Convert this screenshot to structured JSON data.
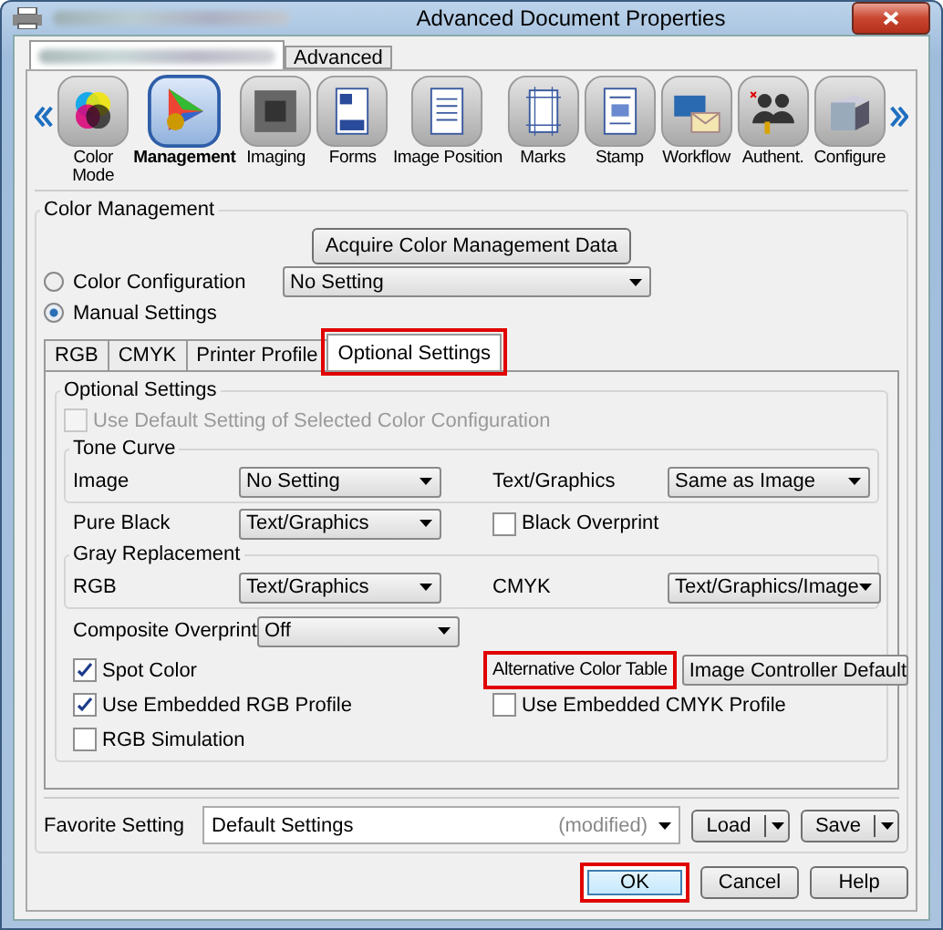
{
  "window": {
    "title": "Advanced Document Properties"
  },
  "top_tabs": [
    {
      "kind": "blurred",
      "selected": true
    },
    {
      "kind": "text",
      "label": "Advanced",
      "selected": false
    }
  ],
  "categories": [
    {
      "label": "Color Mode",
      "kind": "color",
      "selected": false
    },
    {
      "label": "Management",
      "kind": "gamut",
      "selected": true
    },
    {
      "label": "Imaging",
      "kind": "imaging",
      "selected": false
    },
    {
      "label": "Forms",
      "kind": "forms",
      "selected": false
    },
    {
      "label": "Image Position",
      "kind": "position",
      "selected": false
    },
    {
      "label": "Marks",
      "kind": "marks",
      "selected": false
    },
    {
      "label": "Stamp",
      "kind": "stamp",
      "selected": false
    },
    {
      "label": "Workflow",
      "kind": "workflow",
      "selected": false
    },
    {
      "label": "Authent.",
      "kind": "auth",
      "selected": false
    },
    {
      "label": "Configure",
      "kind": "configure",
      "selected": false
    }
  ],
  "color_management": {
    "title": "Color Management",
    "acquire_button": "Acquire Color Management Data",
    "modes": [
      {
        "label": "Color Configuration",
        "selected": false
      },
      {
        "label": "Manual Settings",
        "selected": true
      }
    ],
    "configuration_value": "No Setting",
    "tabs": [
      {
        "label": "RGB",
        "selected": false,
        "highlighted": false
      },
      {
        "label": "CMYK",
        "selected": false,
        "highlighted": false
      },
      {
        "label": "Printer Profile",
        "selected": false,
        "highlighted": false
      },
      {
        "label": "Optional Settings",
        "selected": true,
        "highlighted": true
      }
    ],
    "optional_settings": {
      "title": "Optional Settings",
      "use_default": {
        "label": "Use Default Setting of Selected Color Configuration",
        "checked": false,
        "disabled": true
      },
      "tone_curve": {
        "title": "Tone Curve",
        "image_label": "Image",
        "image_value": "No Setting",
        "text_label": "Text/Graphics",
        "text_value": "Same as Image"
      },
      "pure_black": {
        "label": "Pure Black",
        "value": "Text/Graphics"
      },
      "black_overprint": {
        "label": "Black Overprint",
        "checked": false
      },
      "gray_replacement": {
        "title": "Gray Replacement",
        "rgb_label": "RGB",
        "rgb_value": "Text/Graphics",
        "cmyk_label": "CMYK",
        "cmyk_value": "Text/Graphics/Image"
      },
      "composite_overprint": {
        "label": "Composite Overprint",
        "value": "Off"
      },
      "spot_color": {
        "label": "Spot Color",
        "checked": true
      },
      "alternative_color_table": {
        "label": "Alternative Color Table",
        "value": "Image Controller Default",
        "highlighted": true
      },
      "embedded_rgb": {
        "label": "Use Embedded RGB Profile",
        "checked": true
      },
      "embedded_cmyk": {
        "label": "Use Embedded CMYK Profile",
        "checked": false
      },
      "rgb_simulation": {
        "label": "RGB Simulation",
        "checked": false
      }
    }
  },
  "favorite": {
    "label": "Favorite Setting",
    "value": "Default Settings",
    "note": "(modified)",
    "load": "Load",
    "save": "Save"
  },
  "buttons": [
    {
      "label": "OK",
      "highlighted": true,
      "default": true
    },
    {
      "label": "Cancel",
      "highlighted": false,
      "default": false
    },
    {
      "label": "Help",
      "highlighted": false,
      "default": false
    }
  ]
}
